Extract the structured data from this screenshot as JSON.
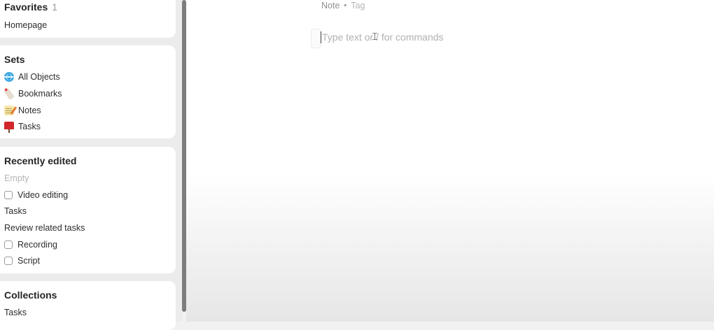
{
  "sidebar": {
    "favorites": {
      "title": "Favorites",
      "count": "1",
      "items": [
        {
          "label": "Homepage"
        }
      ]
    },
    "sets": {
      "title": "Sets",
      "items": [
        {
          "label": "All Objects",
          "icon": "globe-icon"
        },
        {
          "label": "Bookmarks",
          "icon": "bookmark-icon"
        },
        {
          "label": "Notes",
          "icon": "notepad-icon"
        },
        {
          "label": "Tasks",
          "icon": "mailbox-icon"
        }
      ]
    },
    "recently_edited": {
      "title": "Recently edited",
      "items": [
        {
          "label": "Empty"
        },
        {
          "label": "Video editing",
          "checkbox": false
        },
        {
          "label": "Tasks"
        },
        {
          "label": "Review related tasks"
        },
        {
          "label": "Recording",
          "checkbox": false
        },
        {
          "label": "Script",
          "checkbox": false
        }
      ]
    },
    "collections": {
      "title": "Collections",
      "items": [
        {
          "label": "Tasks"
        }
      ]
    }
  },
  "main": {
    "object_type": "Note",
    "separator": "•",
    "tag": "Tag",
    "editor_placeholder": "Type text or / for commands"
  }
}
